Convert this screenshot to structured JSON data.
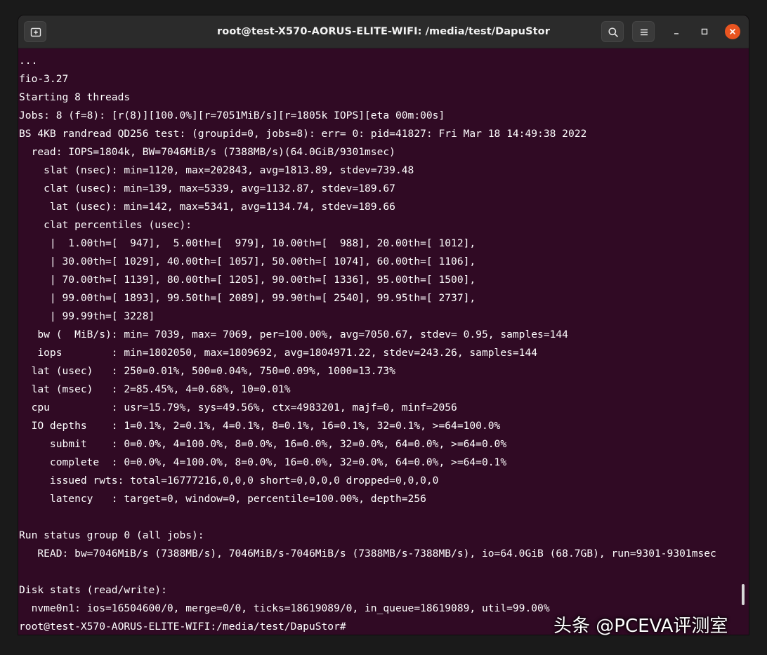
{
  "window": {
    "title": "root@test-X570-AORUS-ELITE-WIFI: /media/test/DapuStor"
  },
  "colors": {
    "terminal_bg": "#300a24",
    "titlebar_bg": "#2b2b2b",
    "close_accent": "#e95420",
    "text": "#ffffff"
  },
  "icons": {
    "new_tab": "new-tab-icon",
    "search": "search-icon",
    "menu": "hamburger-menu-icon",
    "minimize": "minimize-icon",
    "maximize": "maximize-icon",
    "close": "close-icon"
  },
  "terminal": {
    "lines": [
      "...",
      "fio-3.27",
      "Starting 8 threads",
      "Jobs: 8 (f=8): [r(8)][100.0%][r=7051MiB/s][r=1805k IOPS][eta 00m:00s]",
      "BS 4KB randread QD256 test: (groupid=0, jobs=8): err= 0: pid=41827: Fri Mar 18 14:49:38 2022",
      "  read: IOPS=1804k, BW=7046MiB/s (7388MB/s)(64.0GiB/9301msec)",
      "    slat (nsec): min=1120, max=202843, avg=1813.89, stdev=739.48",
      "    clat (usec): min=139, max=5339, avg=1132.87, stdev=189.67",
      "     lat (usec): min=142, max=5341, avg=1134.74, stdev=189.66",
      "    clat percentiles (usec):",
      "     |  1.00th=[  947],  5.00th=[  979], 10.00th=[  988], 20.00th=[ 1012],",
      "     | 30.00th=[ 1029], 40.00th=[ 1057], 50.00th=[ 1074], 60.00th=[ 1106],",
      "     | 70.00th=[ 1139], 80.00th=[ 1205], 90.00th=[ 1336], 95.00th=[ 1500],",
      "     | 99.00th=[ 1893], 99.50th=[ 2089], 99.90th=[ 2540], 99.95th=[ 2737],",
      "     | 99.99th=[ 3228]",
      "   bw (  MiB/s): min= 7039, max= 7069, per=100.00%, avg=7050.67, stdev= 0.95, samples=144",
      "   iops        : min=1802050, max=1809692, avg=1804971.22, stdev=243.26, samples=144",
      "  lat (usec)   : 250=0.01%, 500=0.04%, 750=0.09%, 1000=13.73%",
      "  lat (msec)   : 2=85.45%, 4=0.68%, 10=0.01%",
      "  cpu          : usr=15.79%, sys=49.56%, ctx=4983201, majf=0, minf=2056",
      "  IO depths    : 1=0.1%, 2=0.1%, 4=0.1%, 8=0.1%, 16=0.1%, 32=0.1%, >=64=100.0%",
      "     submit    : 0=0.0%, 4=100.0%, 8=0.0%, 16=0.0%, 32=0.0%, 64=0.0%, >=64=0.0%",
      "     complete  : 0=0.0%, 4=100.0%, 8=0.0%, 16=0.0%, 32=0.0%, 64=0.0%, >=64=0.1%",
      "     issued rwts: total=16777216,0,0,0 short=0,0,0,0 dropped=0,0,0,0",
      "     latency   : target=0, window=0, percentile=100.00%, depth=256",
      "",
      "Run status group 0 (all jobs):",
      "   READ: bw=7046MiB/s (7388MB/s), 7046MiB/s-7046MiB/s (7388MB/s-7388MB/s), io=64.0GiB (68.7GB), run=9301-9301msec",
      "",
      "Disk stats (read/write):",
      "  nvme0n1: ios=16504600/0, merge=0/0, ticks=18619089/0, in_queue=18619089, util=99.00%",
      "root@test-X570-AORUS-ELITE-WIFI:/media/test/DapuStor#"
    ]
  },
  "watermark": {
    "text": "头条 @PCEVA评测室"
  }
}
